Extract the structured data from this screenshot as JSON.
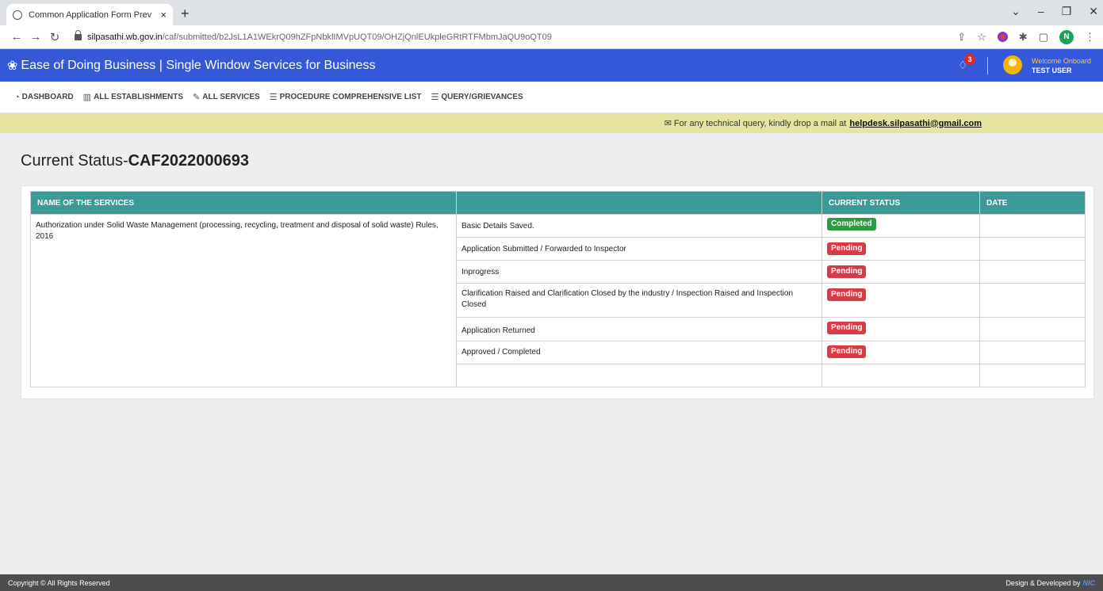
{
  "browser": {
    "tab_title": "Common Application Form Prev",
    "tab_close": "×",
    "new_tab": "+",
    "url_host": "silpasathi.wb.gov.in",
    "url_path": "/caf/submitted/b2JsL1A1WEkrQ09hZFpNbklIMVpUQT09/OHZjQnlEUkpleGRtRTFMbmJaQU9oQT09",
    "profile_initial": "N"
  },
  "header": {
    "title": "Ease of Doing Business | Single Window Services for Business",
    "notification_count": "3",
    "welcome_label": "Welcome Onboard",
    "user_name": "TEST USER"
  },
  "nav": {
    "items": [
      {
        "label": "DASHBOARD",
        "icon": "dashboard-icon"
      },
      {
        "label": "ALL ESTABLISHMENTS",
        "icon": "building-icon"
      },
      {
        "label": "ALL SERVICES",
        "icon": "wrench-icon"
      },
      {
        "label": "PROCEDURE COMPREHENSIVE LIST",
        "icon": "list-icon"
      },
      {
        "label": "QUERY/GRIEVANCES",
        "icon": "list-icon"
      }
    ]
  },
  "info": {
    "text": "For any technical query, kindly drop a mail at",
    "email": "helpdesk.silpasathi@gmail.com"
  },
  "page": {
    "title_prefix": "Current Status-",
    "caf_number": "CAF2022000693"
  },
  "table": {
    "headers": [
      "NAME OF THE SERVICES",
      "",
      "CURRENT STATUS",
      "DATE"
    ],
    "service_name": "Authorization under Solid Waste Management (processing, recycling, treatment and disposal of solid waste) Rules, 2016",
    "rows": [
      {
        "step": "Basic Details Saved.",
        "status": "Completed",
        "date": ""
      },
      {
        "step": "Application Submitted / Forwarded to Inspector",
        "status": "Pending",
        "date": ""
      },
      {
        "step": "Inprogress",
        "status": "Pending",
        "date": ""
      },
      {
        "step": "Clarification Raised and Clarification Closed by the industry / Inspection Raised and Inspection Closed",
        "status": "Pending",
        "date": ""
      },
      {
        "step": "Application Returned",
        "status": "Pending",
        "date": ""
      },
      {
        "step": "Approved / Completed",
        "status": "Pending",
        "date": ""
      }
    ]
  },
  "colors": {
    "completed": "#2a9d3f",
    "pending": "#d93a45",
    "header_blue": "#3558d8",
    "table_head": "#3a9a98"
  },
  "footer": {
    "copyright": "Copyright © All Rights Reserved",
    "credit": "Design & Developed by",
    "credit_logo": "NIC"
  }
}
